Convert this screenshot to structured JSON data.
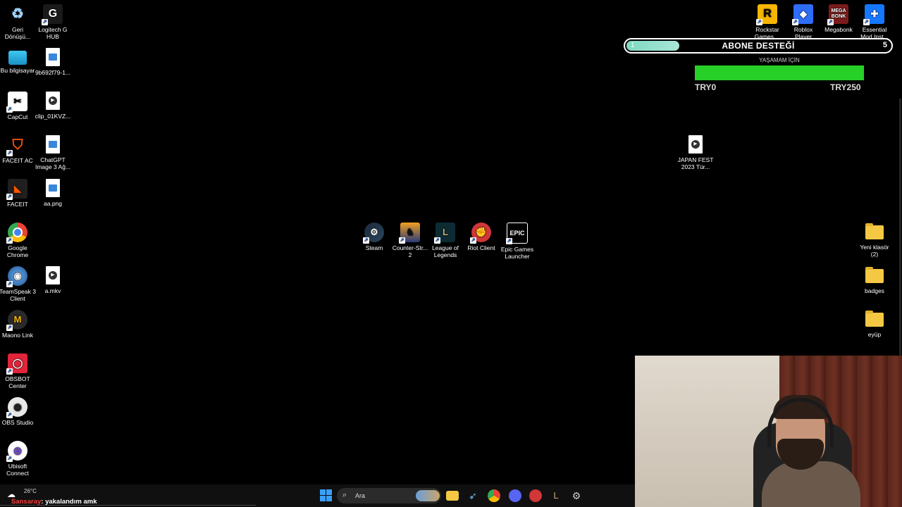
{
  "desktop": {
    "left_col1": [
      {
        "label": "Geri Dönüşü...",
        "icon": "recycle-bin-icon"
      },
      {
        "label": "Bu bilgisayar",
        "icon": "computer-icon"
      },
      {
        "label": "CapCut",
        "icon": "capcut-icon"
      },
      {
        "label": "FACEIT AC",
        "icon": "faceit-ac-icon"
      },
      {
        "label": "FACEIT",
        "icon": "faceit-icon"
      },
      {
        "label": "Google Chrome",
        "icon": "chrome-icon"
      },
      {
        "label": "TeamSpeak 3 Client",
        "icon": "teamspeak-icon"
      },
      {
        "label": "Maono Link",
        "icon": "maono-icon"
      },
      {
        "label": "OBSBOT Center",
        "icon": "obsbot-icon"
      },
      {
        "label": "OBS Studio",
        "icon": "obs-icon"
      },
      {
        "label": "Ubisoft Connect",
        "icon": "ubisoft-icon"
      }
    ],
    "left_col2": [
      {
        "label": "Logitech G HUB",
        "icon": "logitech-icon"
      },
      {
        "label": "9b692f79-1...",
        "icon": "image-file-icon"
      },
      {
        "label": "clip_01KVZ...",
        "icon": "video-file-icon"
      },
      {
        "label": "ChatGPT Image 3 Ağ...",
        "icon": "image-file-icon"
      },
      {
        "label": "aa.png",
        "icon": "image-file-icon"
      },
      {
        "label": "a.mkv",
        "icon": "video-file-icon"
      }
    ],
    "center": [
      {
        "label": "Steam",
        "icon": "steam-icon"
      },
      {
        "label": "Counter-Str... 2",
        "icon": "cs2-icon"
      },
      {
        "label": "League of Legends",
        "icon": "league-icon"
      },
      {
        "label": "Riot Client",
        "icon": "riot-icon"
      },
      {
        "label": "Epic Games Launcher",
        "icon": "epic-icon"
      }
    ],
    "top_right": [
      {
        "label": "Rockstar Games ...",
        "icon": "rockstar-icon"
      },
      {
        "label": "Roblox Player",
        "icon": "roblox-icon"
      },
      {
        "label": "Megabonk",
        "icon": "megabonk-icon"
      },
      {
        "label": "Essential Mod Inst...",
        "icon": "essential-icon"
      }
    ],
    "japan_fest": {
      "label": "JAPAN FEST 2023 ",
      "label2": "Tür...",
      "icon": "video-file-icon"
    },
    "right_folders": [
      {
        "label": "Yeni klasör (2)"
      },
      {
        "label": "badges"
      },
      {
        "label": "eyüp"
      }
    ]
  },
  "overlay": {
    "goal": {
      "title": "ABONE DESTEĞİ",
      "start": "1",
      "end": "5",
      "progress": 0.2
    },
    "donation": {
      "title": "YAŞAMAM İÇİN",
      "min": "TRY0",
      "max": "TRY250",
      "progress": 1.0,
      "fill_color": "#27d027"
    }
  },
  "taskbar": {
    "weather_temp": "26°C",
    "ticker_user": "Sansaray",
    "ticker_message": ": yakalandım amk",
    "search_placeholder": "Ara"
  },
  "colors": {
    "goal_fill": "#a8e6d8",
    "donation_fill": "#27d027",
    "ticker_user": "#ff3b3b"
  }
}
